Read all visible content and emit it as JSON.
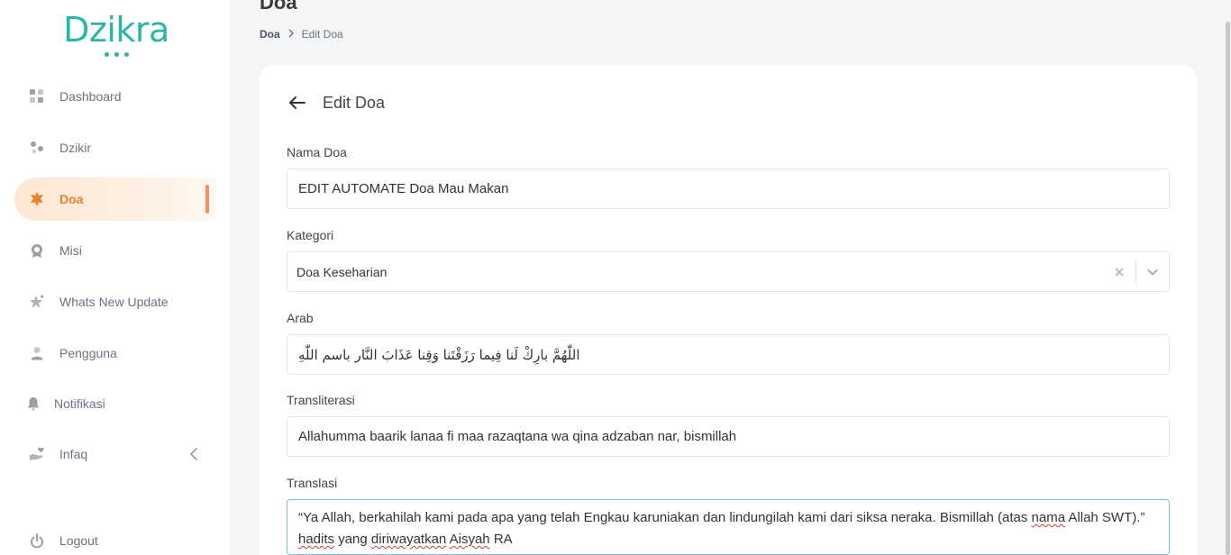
{
  "brand": {
    "name": "Dzikra",
    "color": "#2bb5a5"
  },
  "sidebar": {
    "items": [
      {
        "label": "Dashboard",
        "icon": "dashboard-grid-icon"
      },
      {
        "label": "Dzikir",
        "icon": "dots-icon"
      },
      {
        "label": "Doa",
        "icon": "star-badge-icon",
        "active": true
      },
      {
        "label": "Misi",
        "icon": "award-icon"
      },
      {
        "label": "Whats New Update",
        "icon": "sparkle-star-icon"
      },
      {
        "label": "Pengguna",
        "icon": "user-icon"
      },
      {
        "label": "Notifikasi",
        "icon": "bell-icon"
      },
      {
        "label": "Infaq",
        "icon": "hand-heart-icon",
        "expandable": true
      },
      {
        "label": "Logout",
        "icon": "power-icon"
      }
    ],
    "active_color": "#e5822e"
  },
  "header": {
    "title": "Doa",
    "breadcrumb": {
      "root": "Doa",
      "separator": ">",
      "current": "Edit Doa"
    }
  },
  "form": {
    "title": "Edit Doa",
    "nama_doa": {
      "label": "Nama Doa",
      "value": "EDIT AUTOMATE Doa Mau Makan"
    },
    "kategori": {
      "label": "Kategori",
      "value": "Doa Keseharian"
    },
    "arab": {
      "label": "Arab",
      "value": "اللّٰهُمَّ بارِكْ لَنا فِيما رَزَقْتَنا وَقِنا عَذَابَ النَّار باسم اللّٰهِ"
    },
    "transliterasi": {
      "label": "Transliterasi",
      "value": "Allahumma baarik lanaa fi maa razaqtana wa qina adzaban nar, bismillah"
    },
    "translasi": {
      "label": "Translasi",
      "value_part1": "“Ya Allah, berkahilah kami pada apa yang telah Engkau karuniakan dan lindungilah kami dari siksa neraka. Bismillah (atas ",
      "value_word_nama": "nama",
      "value_part2": " Allah SWT).” ",
      "value_word_hadits": "hadits",
      "value_part3": " yang ",
      "value_word_diriwayatkan": "diriwayatkan",
      "value_part4": " ",
      "value_word_aisyah": "Aisyah",
      "value_part5": " RA"
    }
  }
}
